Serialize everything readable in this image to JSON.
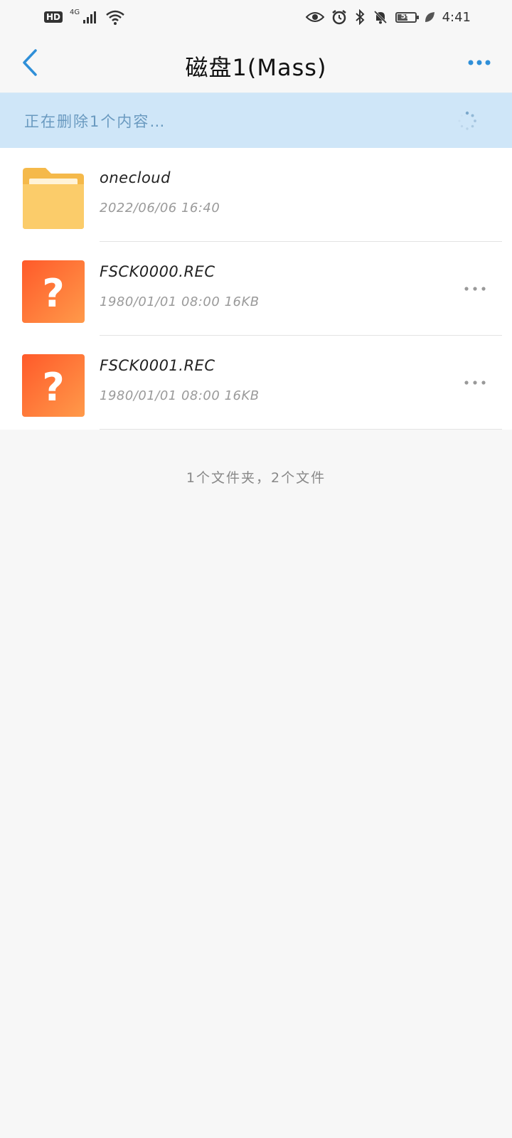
{
  "status_bar": {
    "hd": "HD",
    "network": "4G",
    "battery_level": "59",
    "time": "4:41"
  },
  "header": {
    "title": "磁盘1(Mass)"
  },
  "progress": {
    "text": "正在删除1个内容…"
  },
  "files": [
    {
      "name": "onecloud",
      "meta": "2022/06/06 16:40",
      "kind": "folder"
    },
    {
      "name": "FSCK0000.REC",
      "meta": "1980/01/01 08:00  16KB",
      "kind": "unknown"
    },
    {
      "name": "FSCK0001.REC",
      "meta": "1980/01/01 08:00  16KB",
      "kind": "unknown"
    }
  ],
  "summary": "1个文件夹，2个文件",
  "colors": {
    "accent": "#2f8fd8",
    "banner": "#cfe6f8",
    "folder": "#f7c35a",
    "unknown_file": "#ff7a3c"
  }
}
